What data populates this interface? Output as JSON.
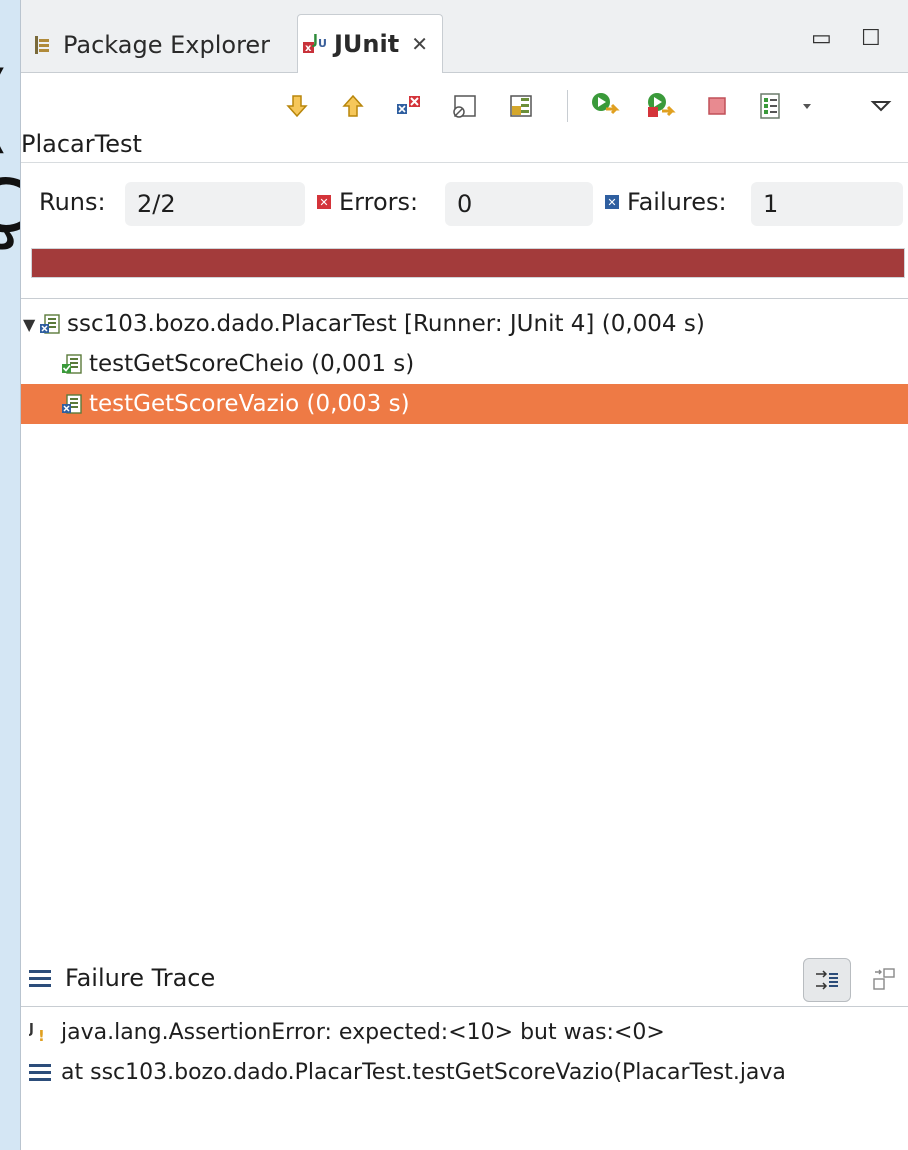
{
  "tabs": {
    "package_explorer": "Package Explorer",
    "junit": "JUnit",
    "close": "✕"
  },
  "window_controls": {
    "minimize": "▭",
    "maximize": "☐"
  },
  "test_class": "PlacarTest",
  "counters": {
    "runs_label": "Runs:",
    "runs_value": "2/2",
    "errors_label": "Errors:",
    "errors_value": "0",
    "failures_label": "Failures:",
    "failures_value": "1"
  },
  "progress": {
    "fraction": 1.0,
    "color": "#a33b3b"
  },
  "tree": {
    "root": "ssc103.bozo.dado.PlacarTest [Runner: JUnit 4] (0,004 s)",
    "children": [
      {
        "label": "testGetScoreCheio (0,001 s)",
        "status": "passed"
      },
      {
        "label": "testGetScoreVazio (0,003 s)",
        "status": "failed",
        "selected": true
      }
    ]
  },
  "failure_trace": {
    "title": "Failure Trace",
    "lines": [
      "java.lang.AssertionError: expected:<10> but was:<0>",
      "at ssc103.bozo.dado.PlacarTest.testGetScoreVazio(PlacarTest.java"
    ]
  },
  "colors": {
    "selection": "#ee7a45",
    "failure_bar": "#a33b3b",
    "error_icon": "#d4343a",
    "failure_icon": "#2f5fa0"
  },
  "background_glyphs": [
    "(",
    "ç"
  ]
}
